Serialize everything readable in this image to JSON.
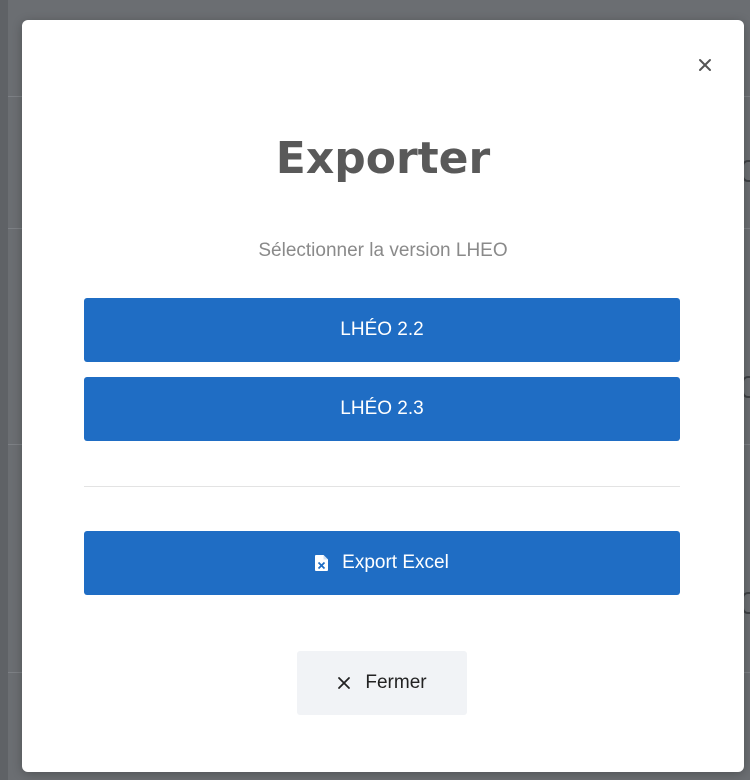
{
  "modal": {
    "title": "Exporter",
    "subtitle": "Sélectionner la version LHEO",
    "buttons": {
      "lheo_22": "LHÉO 2.2",
      "lheo_23": "LHÉO 2.3",
      "export_excel": "Export Excel",
      "close": "Fermer"
    },
    "icons": {
      "close_top": "close-icon",
      "excel": "file-excel-icon",
      "close_button": "close-icon"
    }
  },
  "colors": {
    "primary": "#1f6dc4",
    "title": "#595959",
    "subtitle": "#8a8a8a",
    "secondary_button": "#f1f3f6",
    "backdrop": "#5f6266"
  }
}
